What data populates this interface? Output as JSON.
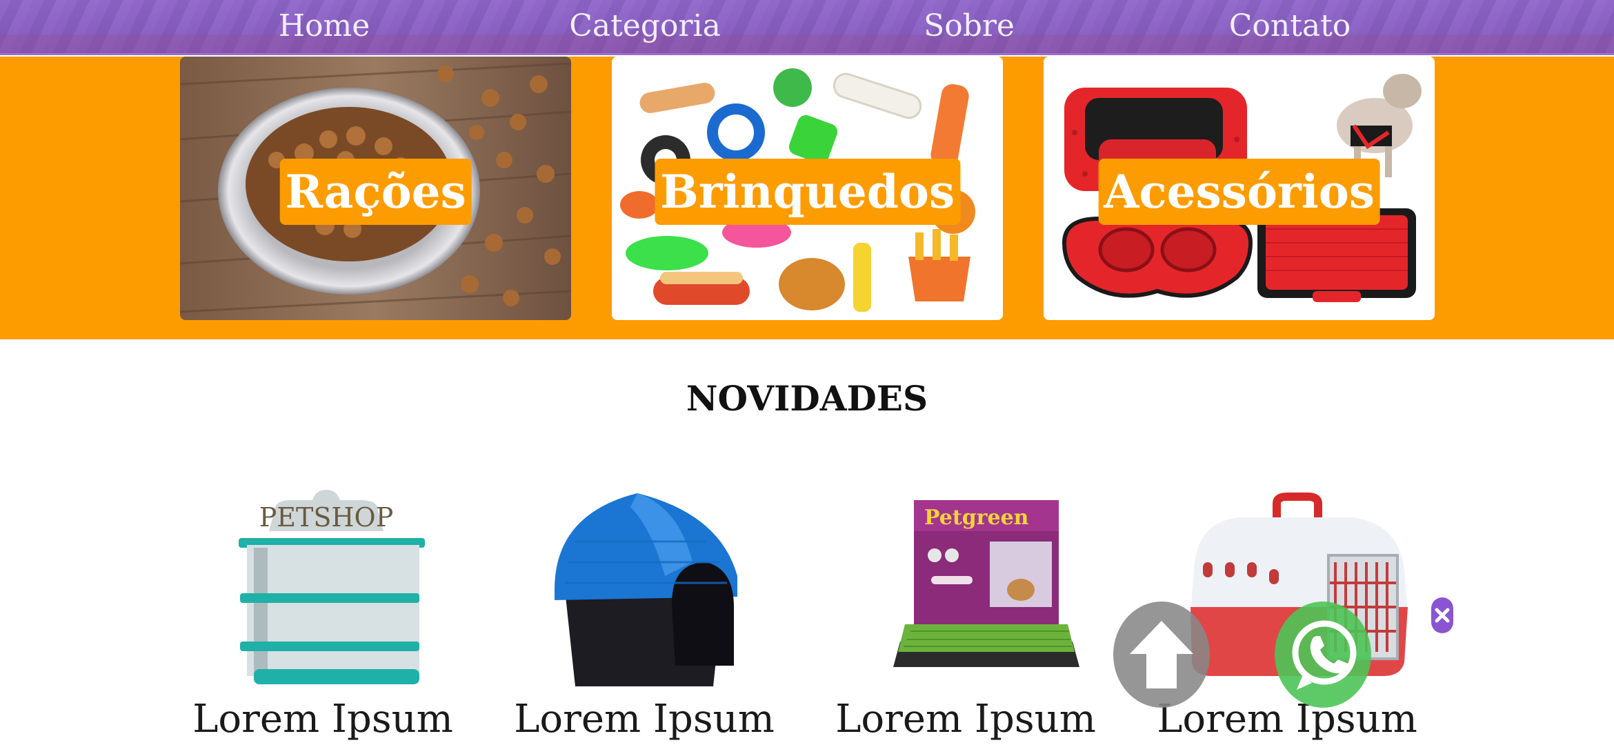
{
  "nav": {
    "items": [
      {
        "label": "Home"
      },
      {
        "label": "Categoria"
      },
      {
        "label": "Sobre"
      },
      {
        "label": "Contato"
      }
    ]
  },
  "categories": [
    {
      "label": "Rações",
      "image": "dog-food-bowl"
    },
    {
      "label": "Brinquedos",
      "image": "pet-toys"
    },
    {
      "label": "Acessórios",
      "image": "pet-accessories"
    }
  ],
  "news": {
    "title": "NOVIDADES",
    "products": [
      {
        "name": "Lorem Ipsum",
        "image": "petshop-display-shelf"
      },
      {
        "name": "Lorem Ipsum",
        "image": "plastic-dog-house"
      },
      {
        "name": "Lorem Ipsum",
        "image": "petgreen-toilet-tray"
      },
      {
        "name": "Lorem Ipsum",
        "image": "pet-carrier"
      }
    ],
    "display_sign_text": "PETSHOP",
    "box_brand_text": "Petgreen"
  },
  "floating": {
    "scroll_top_icon": "arrow-up-icon",
    "whatsapp_icon": "whatsapp-icon",
    "close_icon": "close-icon"
  },
  "colors": {
    "nav_purple": "#8a5fc6",
    "category_orange": "#fd9c01",
    "whatsapp_green": "#4cc456",
    "scroll_gray": "#878787"
  }
}
